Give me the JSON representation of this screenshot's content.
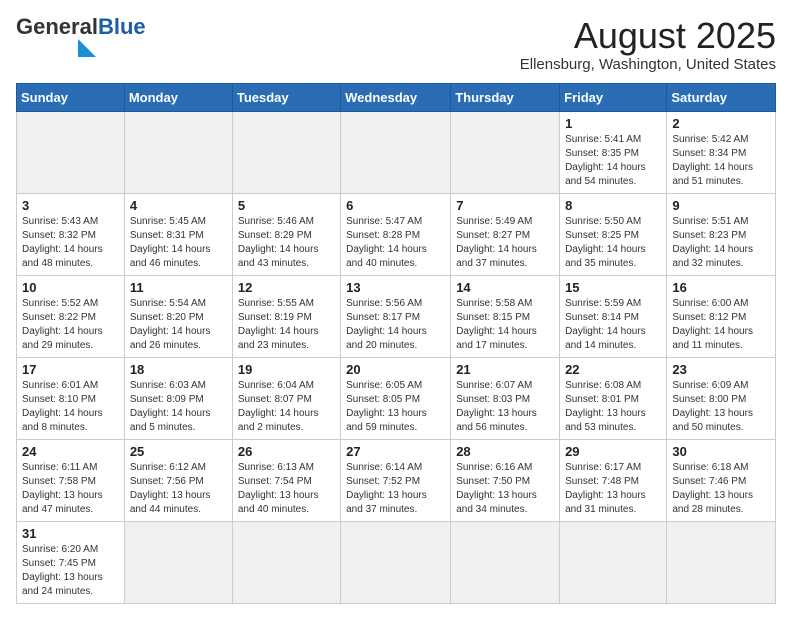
{
  "header": {
    "logo_text_general": "General",
    "logo_text_blue": "Blue",
    "calendar_title": "August 2025",
    "calendar_subtitle": "Ellensburg, Washington, United States"
  },
  "weekdays": [
    "Sunday",
    "Monday",
    "Tuesday",
    "Wednesday",
    "Thursday",
    "Friday",
    "Saturday"
  ],
  "weeks": [
    [
      {
        "day": "",
        "info": ""
      },
      {
        "day": "",
        "info": ""
      },
      {
        "day": "",
        "info": ""
      },
      {
        "day": "",
        "info": ""
      },
      {
        "day": "",
        "info": ""
      },
      {
        "day": "1",
        "info": "Sunrise: 5:41 AM\nSunset: 8:35 PM\nDaylight: 14 hours and 54 minutes."
      },
      {
        "day": "2",
        "info": "Sunrise: 5:42 AM\nSunset: 8:34 PM\nDaylight: 14 hours and 51 minutes."
      }
    ],
    [
      {
        "day": "3",
        "info": "Sunrise: 5:43 AM\nSunset: 8:32 PM\nDaylight: 14 hours and 48 minutes."
      },
      {
        "day": "4",
        "info": "Sunrise: 5:45 AM\nSunset: 8:31 PM\nDaylight: 14 hours and 46 minutes."
      },
      {
        "day": "5",
        "info": "Sunrise: 5:46 AM\nSunset: 8:29 PM\nDaylight: 14 hours and 43 minutes."
      },
      {
        "day": "6",
        "info": "Sunrise: 5:47 AM\nSunset: 8:28 PM\nDaylight: 14 hours and 40 minutes."
      },
      {
        "day": "7",
        "info": "Sunrise: 5:49 AM\nSunset: 8:27 PM\nDaylight: 14 hours and 37 minutes."
      },
      {
        "day": "8",
        "info": "Sunrise: 5:50 AM\nSunset: 8:25 PM\nDaylight: 14 hours and 35 minutes."
      },
      {
        "day": "9",
        "info": "Sunrise: 5:51 AM\nSunset: 8:23 PM\nDaylight: 14 hours and 32 minutes."
      }
    ],
    [
      {
        "day": "10",
        "info": "Sunrise: 5:52 AM\nSunset: 8:22 PM\nDaylight: 14 hours and 29 minutes."
      },
      {
        "day": "11",
        "info": "Sunrise: 5:54 AM\nSunset: 8:20 PM\nDaylight: 14 hours and 26 minutes."
      },
      {
        "day": "12",
        "info": "Sunrise: 5:55 AM\nSunset: 8:19 PM\nDaylight: 14 hours and 23 minutes."
      },
      {
        "day": "13",
        "info": "Sunrise: 5:56 AM\nSunset: 8:17 PM\nDaylight: 14 hours and 20 minutes."
      },
      {
        "day": "14",
        "info": "Sunrise: 5:58 AM\nSunset: 8:15 PM\nDaylight: 14 hours and 17 minutes."
      },
      {
        "day": "15",
        "info": "Sunrise: 5:59 AM\nSunset: 8:14 PM\nDaylight: 14 hours and 14 minutes."
      },
      {
        "day": "16",
        "info": "Sunrise: 6:00 AM\nSunset: 8:12 PM\nDaylight: 14 hours and 11 minutes."
      }
    ],
    [
      {
        "day": "17",
        "info": "Sunrise: 6:01 AM\nSunset: 8:10 PM\nDaylight: 14 hours and 8 minutes."
      },
      {
        "day": "18",
        "info": "Sunrise: 6:03 AM\nSunset: 8:09 PM\nDaylight: 14 hours and 5 minutes."
      },
      {
        "day": "19",
        "info": "Sunrise: 6:04 AM\nSunset: 8:07 PM\nDaylight: 14 hours and 2 minutes."
      },
      {
        "day": "20",
        "info": "Sunrise: 6:05 AM\nSunset: 8:05 PM\nDaylight: 13 hours and 59 minutes."
      },
      {
        "day": "21",
        "info": "Sunrise: 6:07 AM\nSunset: 8:03 PM\nDaylight: 13 hours and 56 minutes."
      },
      {
        "day": "22",
        "info": "Sunrise: 6:08 AM\nSunset: 8:01 PM\nDaylight: 13 hours and 53 minutes."
      },
      {
        "day": "23",
        "info": "Sunrise: 6:09 AM\nSunset: 8:00 PM\nDaylight: 13 hours and 50 minutes."
      }
    ],
    [
      {
        "day": "24",
        "info": "Sunrise: 6:11 AM\nSunset: 7:58 PM\nDaylight: 13 hours and 47 minutes."
      },
      {
        "day": "25",
        "info": "Sunrise: 6:12 AM\nSunset: 7:56 PM\nDaylight: 13 hours and 44 minutes."
      },
      {
        "day": "26",
        "info": "Sunrise: 6:13 AM\nSunset: 7:54 PM\nDaylight: 13 hours and 40 minutes."
      },
      {
        "day": "27",
        "info": "Sunrise: 6:14 AM\nSunset: 7:52 PM\nDaylight: 13 hours and 37 minutes."
      },
      {
        "day": "28",
        "info": "Sunrise: 6:16 AM\nSunset: 7:50 PM\nDaylight: 13 hours and 34 minutes."
      },
      {
        "day": "29",
        "info": "Sunrise: 6:17 AM\nSunset: 7:48 PM\nDaylight: 13 hours and 31 minutes."
      },
      {
        "day": "30",
        "info": "Sunrise: 6:18 AM\nSunset: 7:46 PM\nDaylight: 13 hours and 28 minutes."
      }
    ],
    [
      {
        "day": "31",
        "info": "Sunrise: 6:20 AM\nSunset: 7:45 PM\nDaylight: 13 hours and 24 minutes."
      },
      {
        "day": "",
        "info": ""
      },
      {
        "day": "",
        "info": ""
      },
      {
        "day": "",
        "info": ""
      },
      {
        "day": "",
        "info": ""
      },
      {
        "day": "",
        "info": ""
      },
      {
        "day": "",
        "info": ""
      }
    ]
  ]
}
